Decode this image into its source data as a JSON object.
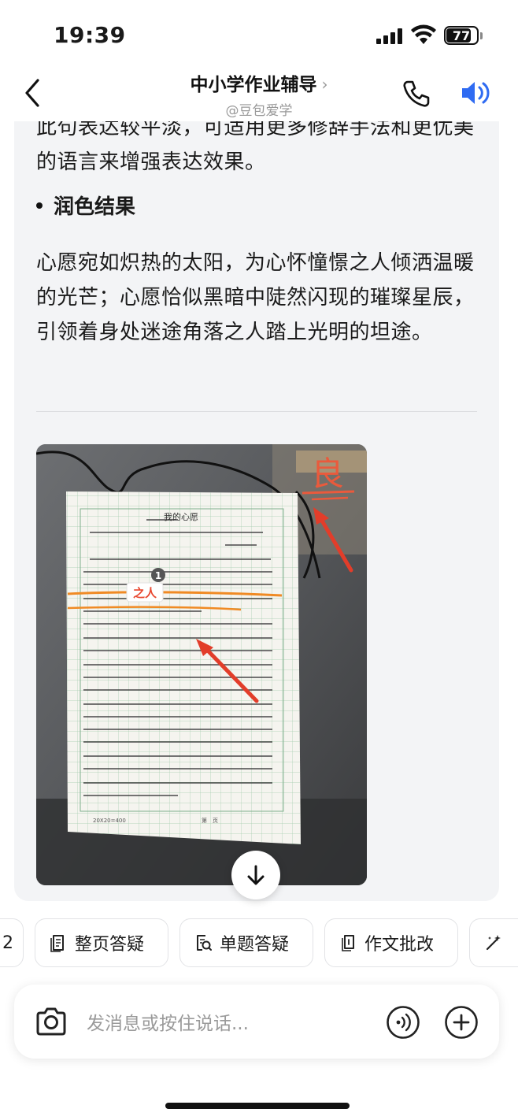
{
  "status_bar": {
    "time": "19:39",
    "battery_level": "77",
    "icons": [
      "signal-icon",
      "wifi-icon",
      "battery-icon"
    ]
  },
  "header": {
    "title": "中小学作业辅导",
    "subtitle": "@豆包爱学",
    "icons": [
      "back-chevron-icon",
      "chevron-right-icon",
      "phone-icon",
      "speaker-icon"
    ],
    "accent_color": "#2f6bf2"
  },
  "message": {
    "partial_paragraph": "此句表达较平淡，可适用更多修辞手法和更优美的语言来增强表达效果。",
    "section_heading": "润色结果",
    "polished_paragraph": "心愿宛如炽热的太阳，为心怀憧憬之人倾洒温暖的光芒；心愿恰似黑暗中陡然闪现的璀璨星辰，引领着身处迷途角落之人踏上光明的坦途。",
    "photo": {
      "grade_mark": "良",
      "annotation_number": "1",
      "annotation_label": "之人",
      "essay_title": "我的心愿",
      "sheet_footer_left": "20X20=400",
      "sheet_footer_center": "第　页"
    }
  },
  "scroll_button": {
    "icon": "arrow-down-icon"
  },
  "chips": [
    {
      "label": "2",
      "icon": ""
    },
    {
      "label": "整页答疑",
      "icon": "page-icon"
    },
    {
      "label": "单题答疑",
      "icon": "question-search-icon"
    },
    {
      "label": "作文批改",
      "icon": "essay-icon"
    },
    {
      "label": "",
      "icon": "magic-wand-icon"
    }
  ],
  "input": {
    "placeholder": "发消息或按住说话...",
    "icons": [
      "camera-icon",
      "voice-wave-icon",
      "plus-icon"
    ]
  }
}
